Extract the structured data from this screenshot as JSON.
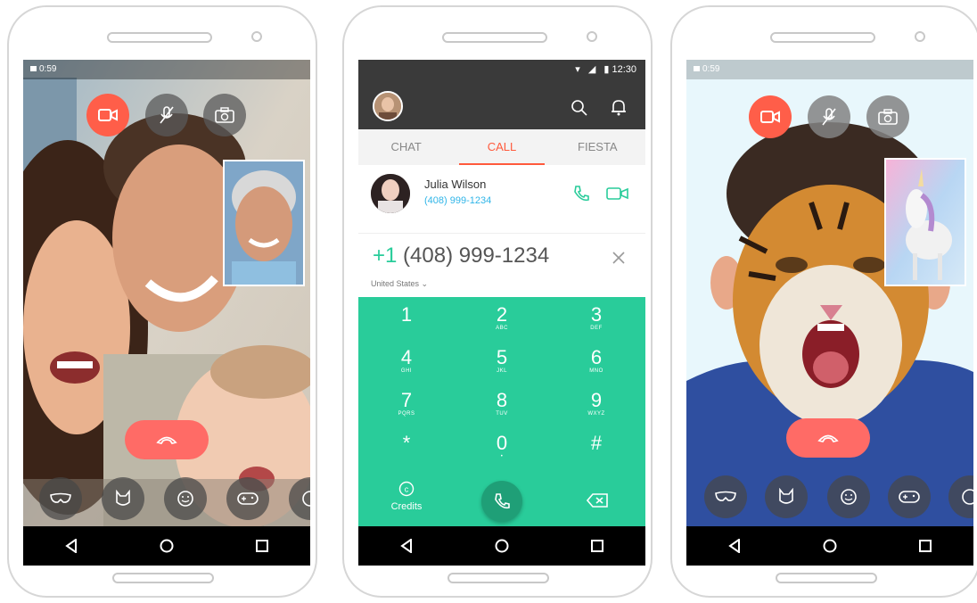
{
  "left_phone": {
    "status_time": "0:59",
    "controls": [
      "camera-toggle-icon",
      "mic-muted-icon",
      "switch-camera-icon"
    ],
    "hangup_icon": "phone-hangup-icon",
    "effects": [
      "mask-icon",
      "cat-face-icon",
      "smiley-icon",
      "gamepad-icon",
      "more-effects-icon"
    ]
  },
  "middle_phone": {
    "status_time": "12:30",
    "tabs": [
      {
        "label": "CHAT",
        "active": false
      },
      {
        "label": "CALL",
        "active": true
      },
      {
        "label": "FIESTA",
        "active": false
      }
    ],
    "contact": {
      "name": "Julia Wilson",
      "phone": "(408) 999-1234"
    },
    "dial_prefix": "+1",
    "dial_number": "(408) 999-1234",
    "country": "United States",
    "keys": [
      {
        "digit": "1",
        "letters": ""
      },
      {
        "digit": "2",
        "letters": "ABC"
      },
      {
        "digit": "3",
        "letters": "DEF"
      },
      {
        "digit": "4",
        "letters": "GHI"
      },
      {
        "digit": "5",
        "letters": "JKL"
      },
      {
        "digit": "6",
        "letters": "MNO"
      },
      {
        "digit": "7",
        "letters": "PQRS"
      },
      {
        "digit": "8",
        "letters": "TUV"
      },
      {
        "digit": "9",
        "letters": "WXYZ"
      },
      {
        "digit": "*",
        "letters": ""
      },
      {
        "digit": "0",
        "letters": "•"
      },
      {
        "digit": "#",
        "letters": ""
      }
    ],
    "credits_label": "Credits",
    "colors": {
      "accent": "#ff5a3c",
      "keypad": "#29cc9a",
      "link": "#2fb5e8"
    }
  },
  "right_phone": {
    "status_time": "0:59",
    "controls": [
      "camera-toggle-icon",
      "mic-muted-icon",
      "switch-camera-icon"
    ],
    "hangup_icon": "phone-hangup-icon",
    "effects": [
      "mask-icon",
      "cat-face-icon",
      "smiley-icon",
      "gamepad-icon",
      "more-effects-icon"
    ]
  }
}
